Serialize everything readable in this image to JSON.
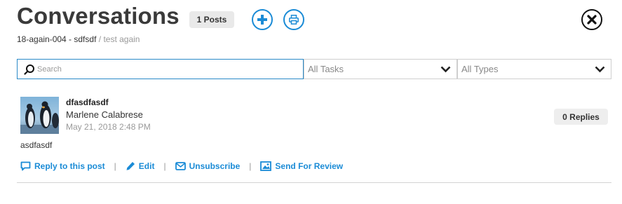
{
  "header": {
    "title": "Conversations",
    "posts_badge": "1 Posts",
    "add_icon": "plus-circle-icon",
    "print_icon": "printer-icon",
    "close_icon": "close-circle-icon"
  },
  "breadcrumb": {
    "main": "18-again-004 - sdfsdf",
    "separator": "/",
    "sub": "test again"
  },
  "filters": {
    "search_placeholder": "Search",
    "search_value": "",
    "tasks_selected": "All Tasks",
    "types_selected": "All Types"
  },
  "post": {
    "title": "dfasdfasdf",
    "author": "Marlene Calabrese",
    "date": "May 21, 2018 2:48 PM",
    "replies": "0 Replies",
    "body": "asdfasdf",
    "actions": [
      {
        "label": "Reply to this post",
        "icon": "comment-icon"
      },
      {
        "label": "Edit",
        "icon": "pencil-icon"
      },
      {
        "label": "Unsubscribe",
        "icon": "envelope-icon"
      },
      {
        "label": "Send For Review",
        "icon": "image-icon"
      }
    ],
    "action_separator": "|"
  },
  "colors": {
    "accent": "#1a8bd6",
    "muted_text": "#999999",
    "badge_bg": "#e9e9e9"
  }
}
